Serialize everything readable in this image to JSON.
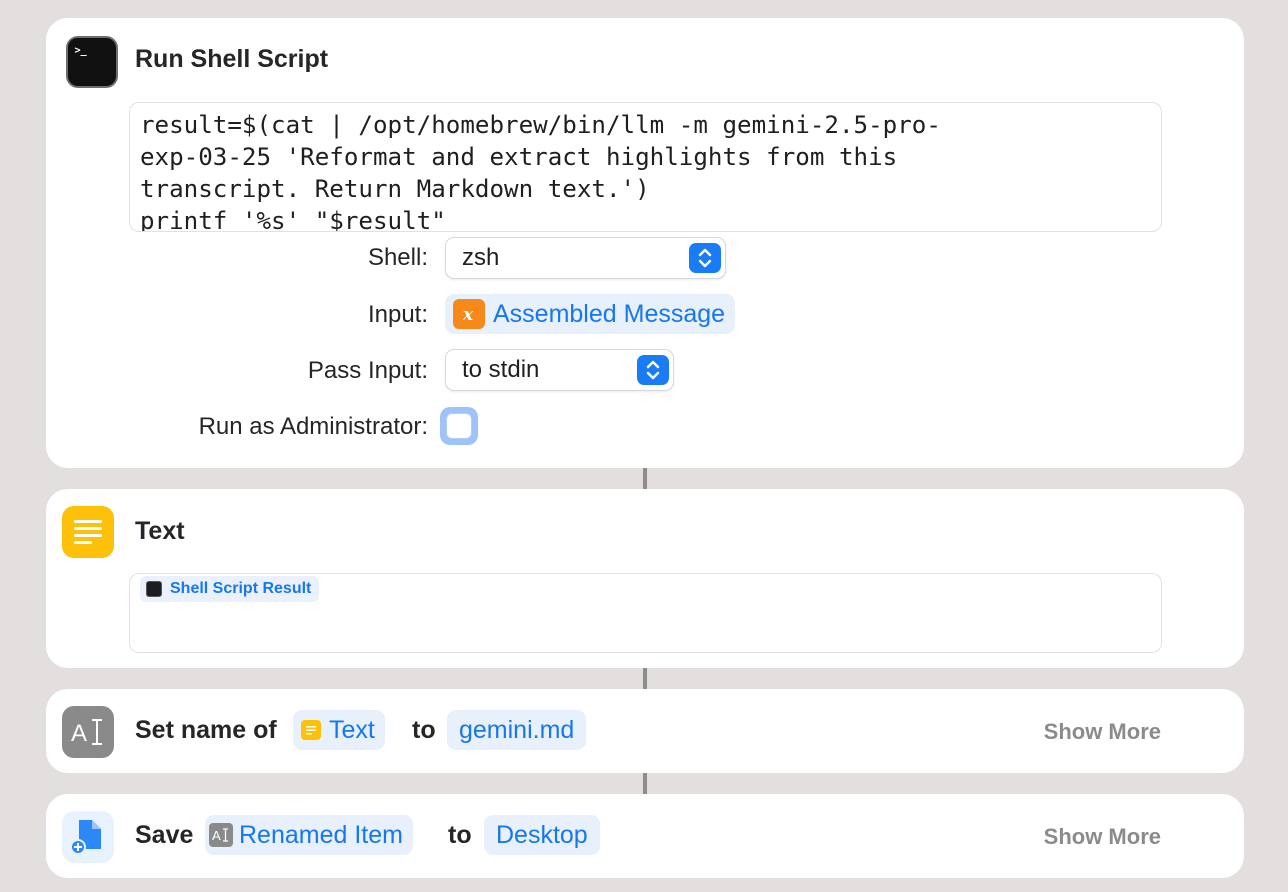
{
  "shell_action": {
    "title": "Run Shell Script",
    "script_lines": [
      "result=$(cat | /opt/homebrew/bin/llm -m gemini-2.5-pro-",
      "exp-03-25 'Reformat and extract highlights from this",
      "transcript. Return Markdown text.')",
      "printf '%s' \"$result\""
    ],
    "shell_label": "Shell:",
    "shell_value": "zsh",
    "input_label": "Input:",
    "input_value": "Assembled Message",
    "pass_input_label": "Pass Input:",
    "pass_input_value": "to stdin",
    "admin_label": "Run as Administrator:",
    "admin_checked": false,
    "icon": "terminal-icon"
  },
  "text_action": {
    "title": "Text",
    "token": "Shell Script Result",
    "icon": "text-lines-icon"
  },
  "rename_action": {
    "label": "Set name of",
    "item_token": "Text",
    "to_label": "to",
    "name_value": "gemini.md",
    "show_more": "Show More",
    "icon": "rename-icon"
  },
  "save_action": {
    "label": "Save",
    "item_token": "Renamed Item",
    "to_label": "to",
    "destination": "Desktop",
    "show_more": "Show More",
    "icon": "save-document-icon"
  },
  "colors": {
    "background": "#e4dfdf",
    "accent": "#1677ee",
    "terminal": "#1d1d1d",
    "text_yellow": "#fdc109",
    "variable_orange": "#f7891b",
    "save_blue": "#2c88f7"
  }
}
